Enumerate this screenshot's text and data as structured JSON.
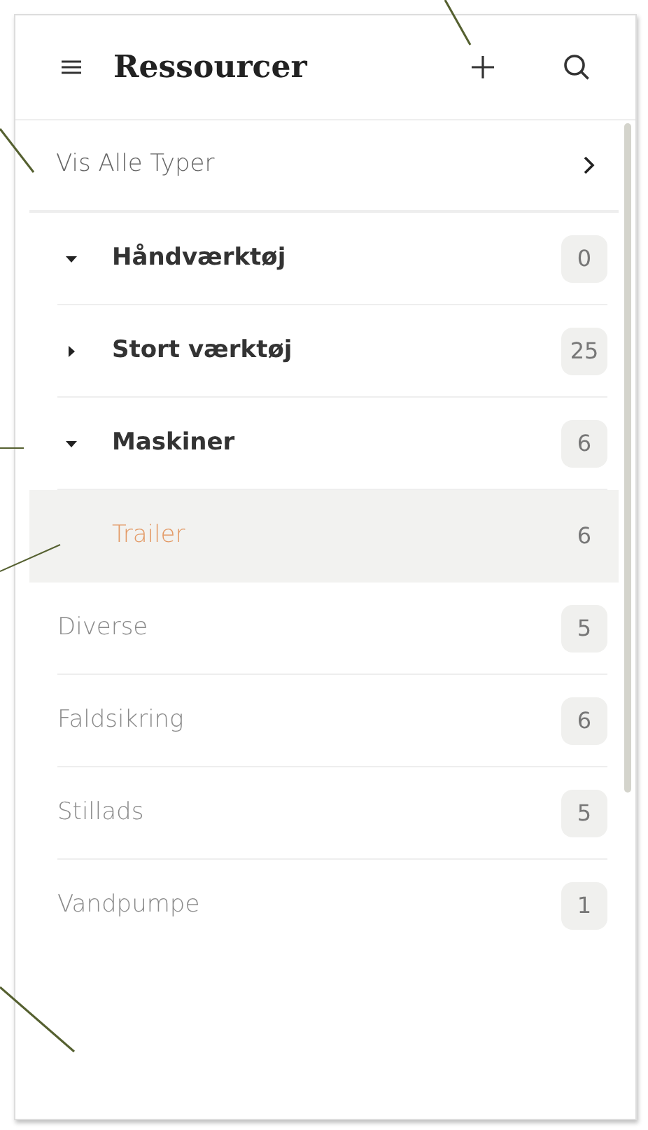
{
  "header": {
    "title": "Ressourcer"
  },
  "show_all": {
    "label": "Vis Alle Typer"
  },
  "categories": [
    {
      "kind": "group",
      "label": "Håndværktøj",
      "count": "0",
      "expanded": true,
      "selected": false
    },
    {
      "kind": "group",
      "label": "Stort værktøj",
      "count": "25",
      "expanded": false,
      "selected": false
    },
    {
      "kind": "group",
      "label": "Maskiner",
      "count": "6",
      "expanded": true,
      "selected": false,
      "children": [
        {
          "kind": "leaf",
          "label": "Trailer",
          "count": "6",
          "selected": true
        }
      ]
    },
    {
      "kind": "leaf",
      "label": "Diverse",
      "count": "5",
      "selected": false
    },
    {
      "kind": "leaf",
      "label": "Faldsikring",
      "count": "6",
      "selected": false
    },
    {
      "kind": "leaf",
      "label": "Stillads",
      "count": "5",
      "selected": false
    },
    {
      "kind": "leaf",
      "label": "Vandpumpe",
      "count": "1",
      "selected": false
    }
  ]
}
